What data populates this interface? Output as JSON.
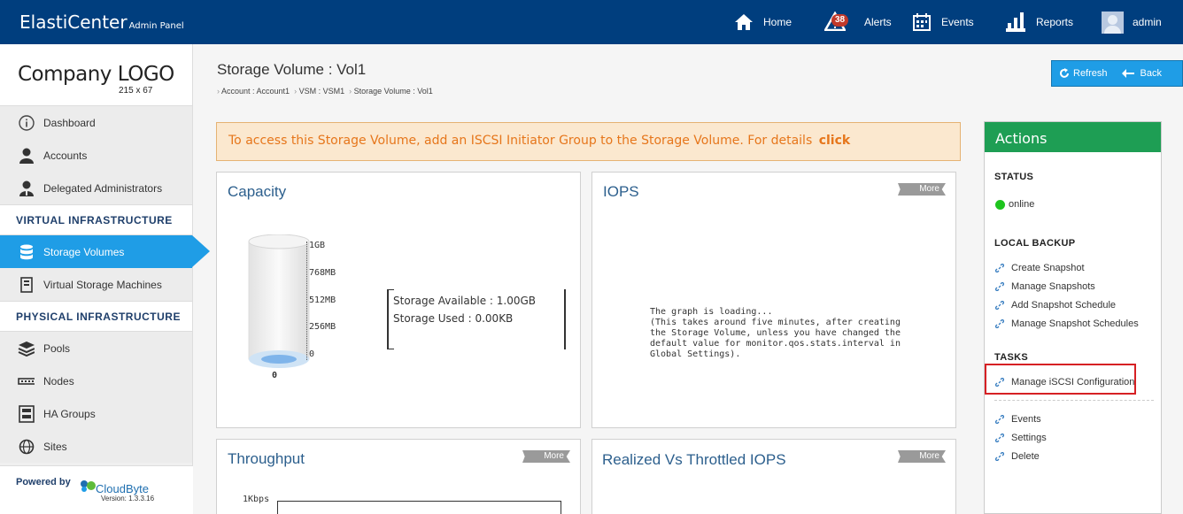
{
  "header": {
    "brand": "ElastiCenter",
    "brand_sub": "Admin Panel",
    "nav": {
      "home": "Home",
      "alerts": "Alerts",
      "alerts_count": "38",
      "events": "Events",
      "reports": "Reports",
      "user": "admin"
    }
  },
  "sidebar": {
    "logo": "Company LOGO",
    "logo_size": "215 x 67",
    "items": [
      "Dashboard",
      "Accounts",
      "Delegated Administrators"
    ],
    "virtual_header": "VIRTUAL INFRASTRUCTURE",
    "virtual_items": [
      "Storage Volumes",
      "Virtual Storage Machines"
    ],
    "physical_header": "PHYSICAL INFRASTRUCTURE",
    "physical_items": [
      "Pools",
      "Nodes",
      "HA Groups",
      "Sites"
    ],
    "powered": "Powered by",
    "powered_brand": "CloudByte",
    "version": "Version: 1.3.3.16"
  },
  "page": {
    "title": "Storage Volume : Vol1",
    "breadcrumb": [
      "Account : Account1",
      "VSM : VSM1",
      "Storage Volume : Vol1"
    ],
    "refresh": "Refresh",
    "back": "Back"
  },
  "alert": {
    "text": "To access this Storage Volume, add an ISCSI Initiator Group to the Storage Volume. For details",
    "link": "click"
  },
  "capacity": {
    "title": "Capacity",
    "ticks": [
      "1GB",
      "768MB",
      "512MB",
      "256MB",
      "0"
    ],
    "value_label": "0",
    "available": "Storage Available : 1.00GB",
    "used": "Storage Used : 0.00KB"
  },
  "iops": {
    "title": "IOPS",
    "more": "More",
    "loading": "The graph is loading...\n(This takes around five minutes, after creating\nthe Storage Volume, unless you have changed the\ndefault value for monitor.qos.stats.interval in\nGlobal Settings)."
  },
  "throughput": {
    "title": "Throughput",
    "more": "More",
    "tick": "1Kbps"
  },
  "realized": {
    "title": "Realized Vs Throttled IOPS",
    "more": "More"
  },
  "actions": {
    "title": "Actions",
    "status_header": "STATUS",
    "status": "online",
    "backup_header": "LOCAL BACKUP",
    "backup_items": [
      "Create Snapshot",
      "Manage Snapshots",
      "Add Snapshot Schedule",
      "Manage Snapshot Schedules"
    ],
    "tasks_header": "TASKS",
    "tasks_items": [
      "Manage iSCSI Configuration"
    ],
    "other_items": [
      "Events",
      "Settings",
      "Delete"
    ]
  },
  "colors": {
    "header": "#003e7e",
    "accent": "#1f9de6",
    "actions_header": "#1e9e54",
    "highlight": "#d62024"
  }
}
